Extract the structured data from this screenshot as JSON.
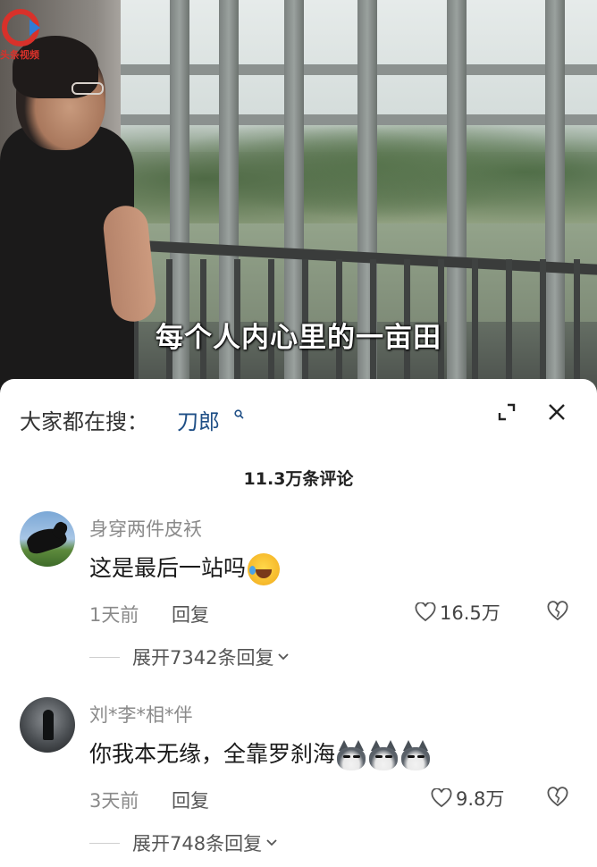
{
  "video": {
    "logo_text": "头条视频",
    "subtitle": "每个人内心里的一亩田"
  },
  "sheet": {
    "search_prefix": "大家都在搜：",
    "search_term": "刀郎",
    "comment_count": "11.3万条评论"
  },
  "comments": [
    {
      "username": "身穿两件皮袄",
      "text": "这是最后一站吗",
      "emoji": "laughing-tears-emoji",
      "time": "1天前",
      "reply_label": "回复",
      "likes": "16.5万",
      "expand_label": "展开7342条回复"
    },
    {
      "username": "刘*李*相*伴",
      "text": "你我本无缘，全靠罗刹海",
      "emoji": "husky-emoji",
      "time": "3天前",
      "reply_label": "回复",
      "likes": "9.8万",
      "expand_label": "展开748条回复"
    }
  ],
  "colors": {
    "accent_link": "#1f4f86",
    "muted_text": "#8a8a8a",
    "logo_red": "#d8312a"
  }
}
